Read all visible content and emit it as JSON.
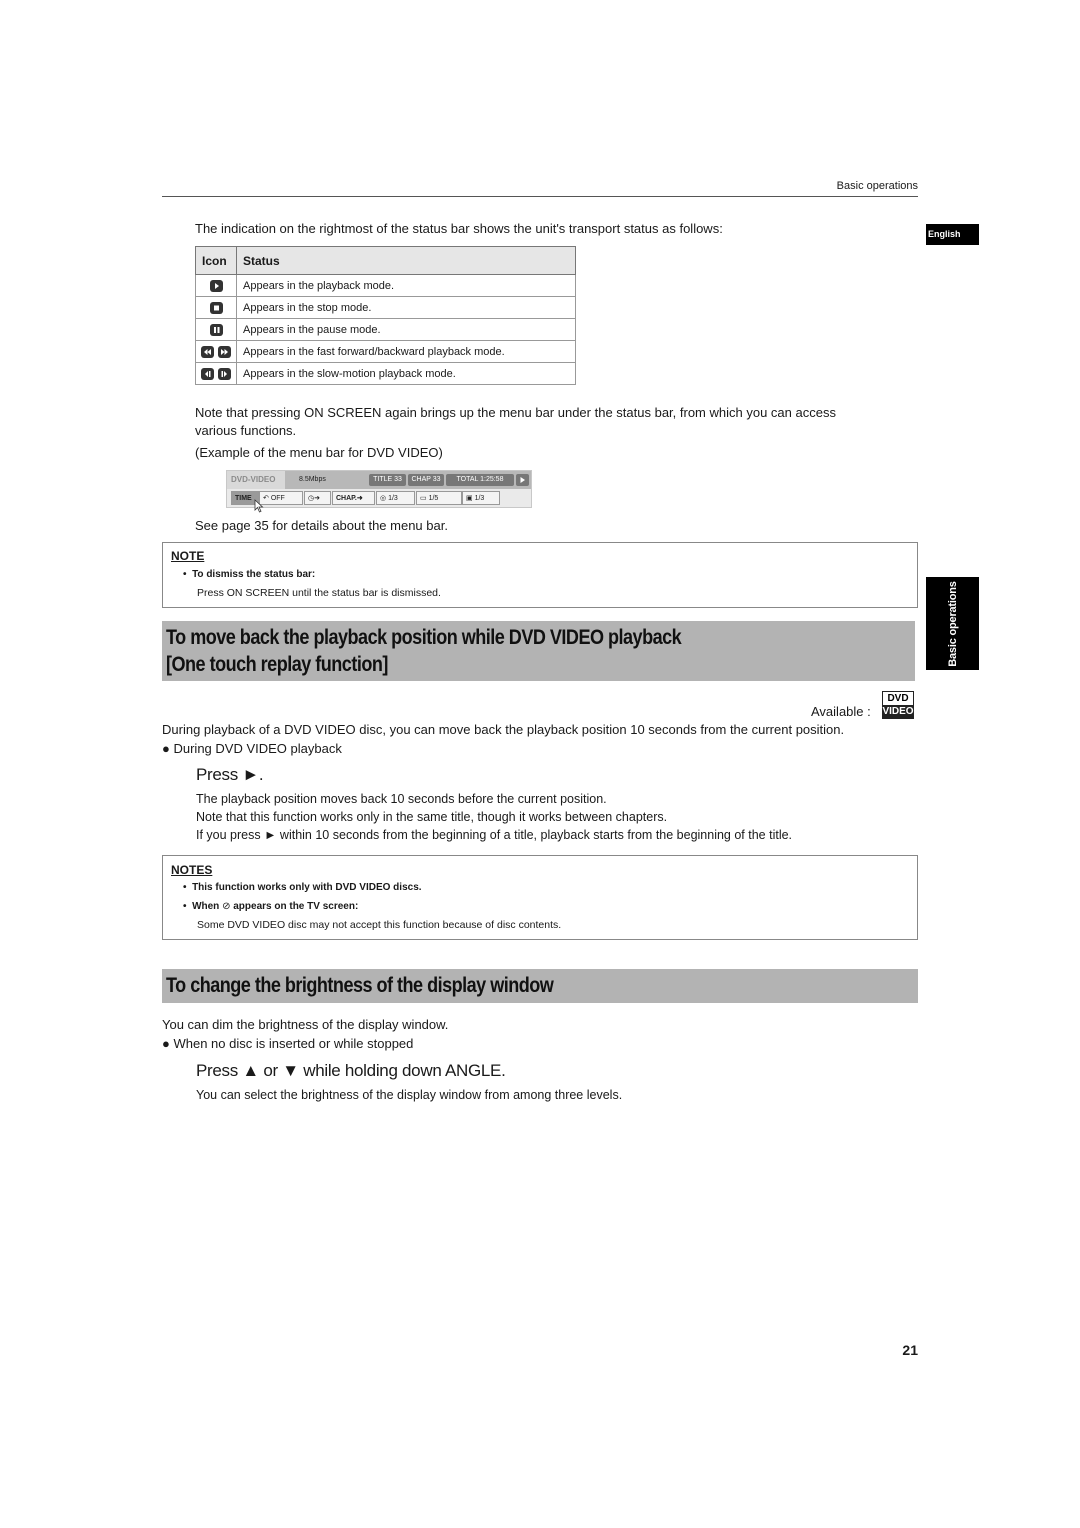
{
  "header": {
    "running_head": "Basic operations",
    "tab_language": "English",
    "tab_section": "Basic operations"
  },
  "intro": "The indication on the rightmost of the status bar shows the unit's transport status as follows:",
  "status_table": {
    "headers": [
      "Icon",
      "Status"
    ],
    "rows": [
      {
        "icons": [
          "play-icon"
        ],
        "status": "Appears in the playback mode."
      },
      {
        "icons": [
          "stop-icon"
        ],
        "status": "Appears in the stop mode."
      },
      {
        "icons": [
          "pause-icon"
        ],
        "status": "Appears in the pause mode."
      },
      {
        "icons": [
          "fast-backward-icon",
          "fast-forward-icon"
        ],
        "status": "Appears in the fast forward/backward playback mode."
      },
      {
        "icons": [
          "slow-backward-icon",
          "slow-forward-icon"
        ],
        "status": "Appears in the slow-motion playback mode."
      }
    ]
  },
  "menu_note": {
    "line1": "Note that pressing ON SCREEN again brings up the menu bar under the status bar, from which you can access",
    "line2": "various functions.",
    "example_caption": "(Example of the menu bar for DVD VIDEO)",
    "see_page": "See page 35 for details about the menu bar."
  },
  "menu_bar": {
    "disc_type": "DVD-VIDEO",
    "bitrate": "8.5Mbps",
    "title": "TITLE 33",
    "chapter": "CHAP 33",
    "total": "TOTAL 1:25:58",
    "items": {
      "time": "TIME",
      "repeat": "OFF",
      "chap": "CHAP.",
      "audio": "1/3",
      "subtitle": "1/5",
      "angle": "1/3"
    }
  },
  "note1": {
    "title": "NOTE",
    "bullet": "To dismiss the status bar:",
    "text": "Press ON SCREEN until the status bar is dismissed."
  },
  "section1": {
    "title_line1": "To move back the playback position while DVD VIDEO playback",
    "title_line2": "[One touch replay function]",
    "available_label": "Available :",
    "logo_top": "DVD",
    "logo_bottom": "VIDEO",
    "body": "During playback of a DVD VIDEO disc, you can move back the playback position 10 seconds from the current position.",
    "condition": "During DVD VIDEO playback",
    "press": "Press ►.",
    "lines": [
      "The playback position moves back 10 seconds before the current position.",
      "Note that this function works only in the same title, though it works between chapters.",
      "If you press ► within 10 seconds from the beginning of a title, playback starts from the beginning of the title."
    ]
  },
  "note2": {
    "title": "NOTES",
    "bullet1": "This function works only with DVD VIDEO discs.",
    "bullet2_pre": "When",
    "bullet2_post": "appears on the TV screen:",
    "text": "Some DVD VIDEO disc may not accept this function because of disc contents."
  },
  "section2": {
    "title": "To change the brightness of the display window",
    "body": "You can dim the brightness of the display window.",
    "condition": "When no disc is inserted or while stopped",
    "press": "Press ▲ or ▼ while holding down ANGLE.",
    "line": "You can select the brightness of the display window from among three levels."
  },
  "page_number": "21"
}
